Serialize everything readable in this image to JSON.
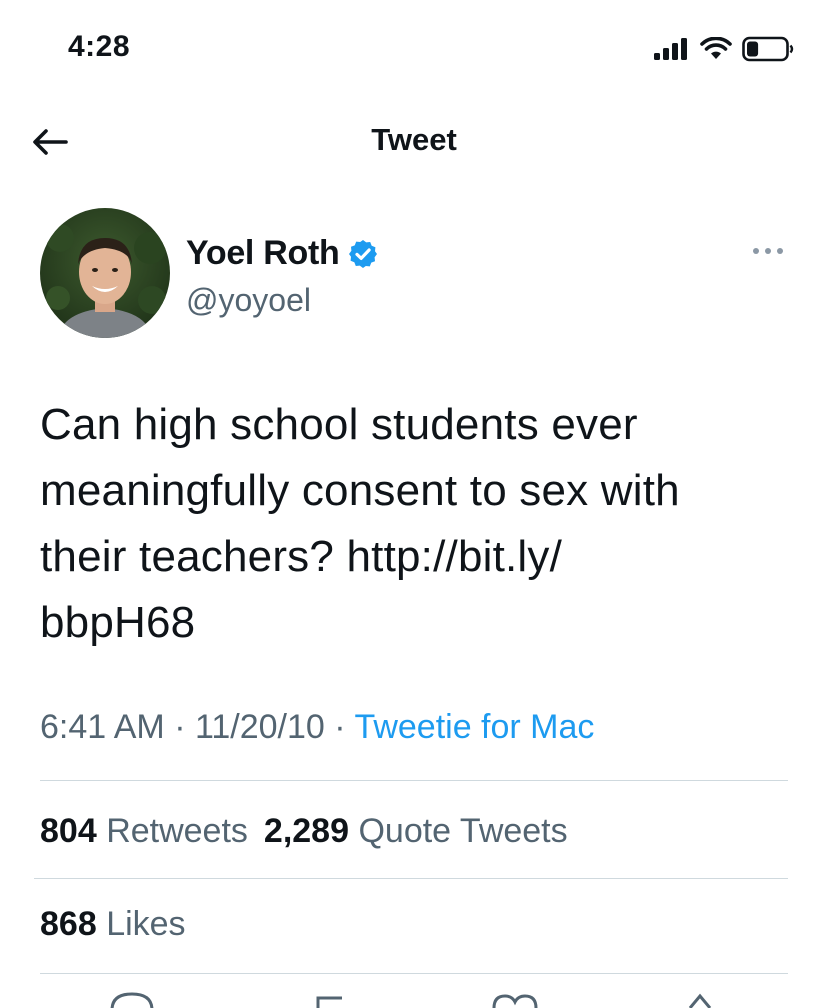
{
  "status_bar": {
    "time": "4:28",
    "signal_bars": 4,
    "battery_level": 0.3
  },
  "header": {
    "title": "Tweet",
    "back_icon": "arrow-left-icon"
  },
  "author": {
    "display_name": "Yoel Roth",
    "username": "@yoyoel",
    "verified": true,
    "verified_color": "#1d9bf0"
  },
  "tweet": {
    "lines": [
      "Can high school students ever",
      "meaningfully consent to sex with",
      "their teachers? http://bit.ly/",
      "bbpH68"
    ],
    "time": "6:41 AM",
    "separator": "·",
    "date": "11/20/10",
    "source": "Tweetie for Mac",
    "source_color": "#1d9bf0"
  },
  "stats": {
    "retweets_count": "804",
    "retweets_label": "Retweets",
    "quotes_count": "2,289",
    "quotes_label": "Quote Tweets",
    "likes_count": "868",
    "likes_label": "Likes"
  }
}
